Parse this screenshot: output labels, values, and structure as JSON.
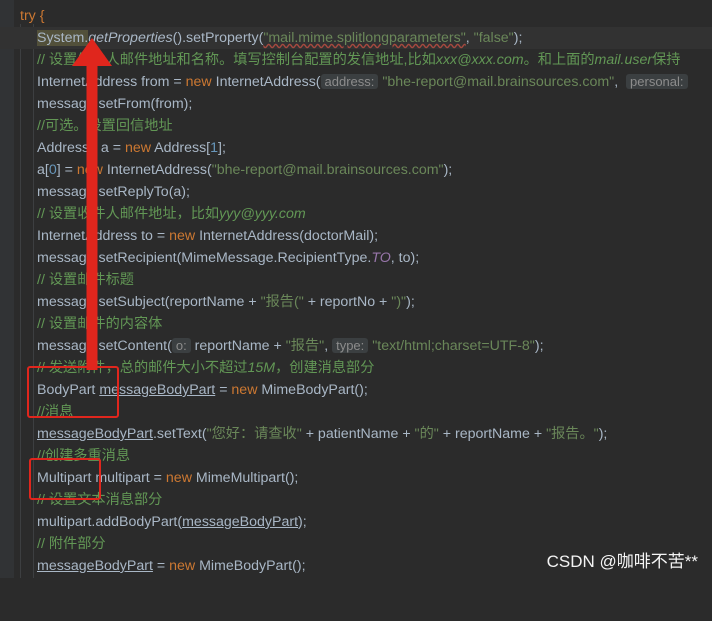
{
  "lines": [
    [
      "try {"
    ],
    [
      "System.",
      "getProperties",
      "().setProperty(",
      "\"mail.mime.splitlongparameters\"",
      ", ",
      "\"false\"",
      ");"
    ],
    [
      "// 设置发件人邮件地址和名称。填写控制台配置的发信地址,比如",
      "xxx@xxx.com",
      "。和上面的",
      "mail.user",
      "保持"
    ],
    [
      "InternetAddress from = ",
      "new ",
      "InternetAddress(",
      "address:",
      " ",
      "\"bhe-report@mail.brainsources.com\"",
      ",  ",
      "personal:"
    ],
    [
      "message.setFrom(from);"
    ],
    [
      "//可选。设置回信地址"
    ],
    [
      "Address[] a = ",
      "new ",
      "Address[",
      "1",
      "];"
    ],
    [
      "a[",
      "0",
      "] = ",
      "new ",
      "InternetAddress(",
      "\"bhe-report@mail.brainsources.com\"",
      ");"
    ],
    [
      "message.setReplyTo(a);"
    ],
    [
      "// 设置收件人邮件地址，比如",
      "yyy@yyy.com"
    ],
    [
      "InternetAddress to = ",
      "new ",
      "InternetAddress(doctorMail);"
    ],
    [
      "message.setRecipient(MimeMessage.RecipientType.",
      "TO",
      ", to);"
    ],
    [
      "// 设置邮件标题"
    ],
    [
      "message.setSubject(reportName + ",
      "\"报告(\"",
      " + reportNo + ",
      "\")\"",
      ");"
    ],
    [
      "// 设置邮件的内容体"
    ],
    [
      "message.setContent(",
      "o:",
      " reportName + ",
      "\"报告\"",
      ", ",
      "type:",
      " ",
      "\"text/html;charset=UTF-8\"",
      ");"
    ],
    [
      "// 发送附件，总的邮件大小不超过",
      "15M",
      "，创建消息部分"
    ],
    [
      "BodyPart ",
      "messageBodyPart",
      " = ",
      "new ",
      "MimeBodyPart();"
    ],
    [
      "//消息"
    ],
    [
      "messageBodyPart",
      ".setText(",
      "\"您好：请查收\"",
      " + patientName + ",
      "\"的\"",
      " + reportName + ",
      "\"报告。\"",
      ");"
    ],
    [
      "//创建多重消息"
    ],
    [
      "Multipart multipart = ",
      "new ",
      "MimeMultipart();"
    ],
    [
      "// 设置文本消息部分"
    ],
    [
      "multipart.addBodyPart(",
      "messageBodyPart",
      ");"
    ],
    [
      "// 附件部分"
    ],
    [
      "messageBodyPart",
      " = ",
      "new ",
      "MimeBodyPart();"
    ]
  ],
  "annotations": {
    "arrow_color": "#e0261d",
    "box_color": "#e0261d"
  },
  "watermark": "CSDN @咖啡不苦**"
}
